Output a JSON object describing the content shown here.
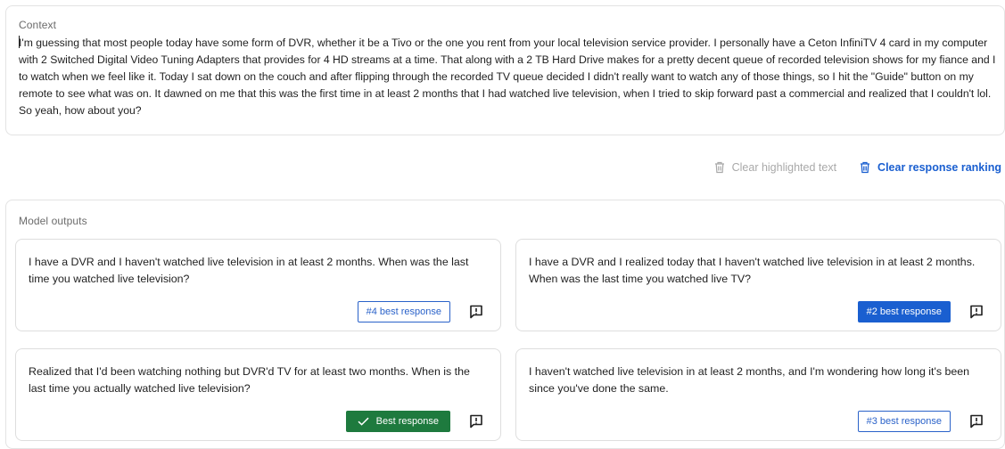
{
  "context": {
    "label": "Context",
    "text": "I'm guessing that most people today have some form of DVR, whether it be a Tivo or the one you rent from your local television service provider. I personally have a Ceton InfiniTV 4 card in my computer with 2 Switched Digital Video Tuning Adapters that provides for 4 HD streams at a time. That along with a 2 TB Hard Drive makes for a pretty decent queue of recorded television shows for my fiance and I to watch when we feel like it. Today I sat down on the couch and after flipping through the recorded TV queue decided I didn't really want to watch any of those things, so I hit the \"Guide\" button on my remote to see what was on. It dawned on me that this was the first time in at least 2 months that I had watched live television, when I tried to skip forward past a commercial and realized that I couldn't lol. So yeah, how about you?"
  },
  "toolbar": {
    "clear_highlighted": "Clear highlighted text",
    "clear_ranking": "Clear response ranking"
  },
  "outputs": {
    "label": "Model outputs",
    "responses": [
      {
        "text": "I have a DVR and I haven't watched live television in at least 2 months. When was the last time you watched live television?",
        "rank_label": "#4 best response"
      },
      {
        "text": "I have a DVR and I realized today that I haven't watched live television in at least 2 months. When was the last time you watched live TV?",
        "rank_label": "#2 best response"
      },
      {
        "text": "Realized that I'd been watching nothing but DVR'd TV for at least two months. When is the last time you actually watched live television?",
        "rank_label": "Best response"
      },
      {
        "text": "I haven't watched live television in at least 2 months, and I'm wondering how long it's been since you've done the same.",
        "rank_label": "#3 best response"
      }
    ]
  },
  "colors": {
    "accent_blue": "#1a5fd0",
    "best_green": "#1e7a3e",
    "disabled_gray": "#a9a9a9"
  },
  "icons": {
    "trash": "trash-icon",
    "check": "check-icon",
    "feedback": "feedback-icon"
  }
}
